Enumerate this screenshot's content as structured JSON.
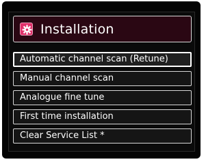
{
  "header": {
    "title": "Installation",
    "icon": "gear-icon",
    "accent_color": "#e0306a",
    "header_bg": "#2a0713"
  },
  "menu": {
    "selected_index": 0,
    "items": [
      {
        "label": "Automatic channel scan (Retune)"
      },
      {
        "label": "Manual channel scan"
      },
      {
        "label": "Analogue fine tune"
      },
      {
        "label": "First time installation"
      },
      {
        "label": "Clear Service List *"
      }
    ]
  }
}
